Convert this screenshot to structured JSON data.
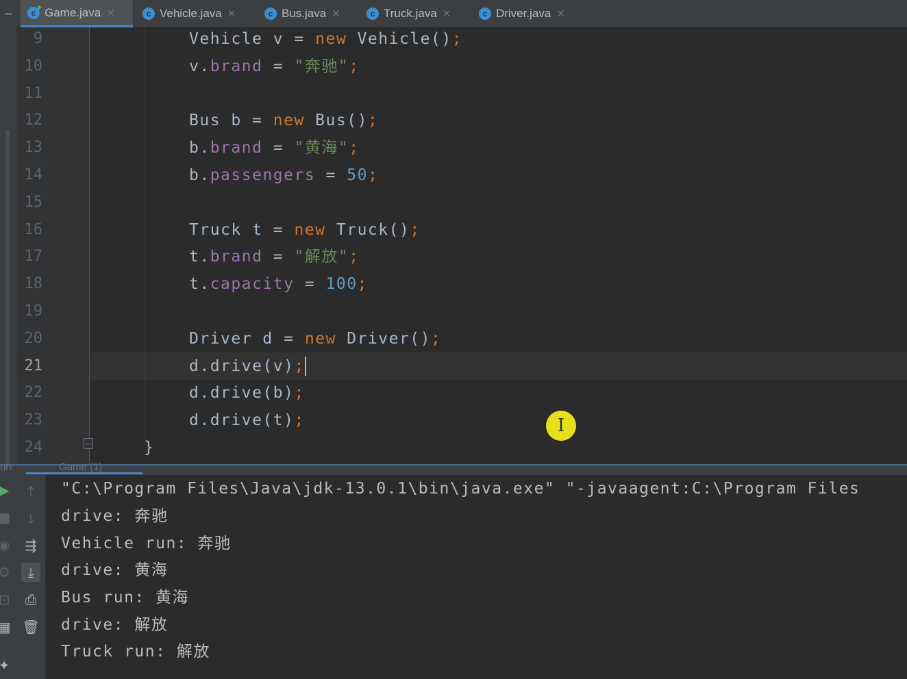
{
  "tabs": [
    {
      "label": "Game.java",
      "icon": "class-icon",
      "active": true
    },
    {
      "label": "Vehicle.java",
      "icon": "class-icon",
      "active": false
    },
    {
      "label": "Bus.java",
      "icon": "class-icon",
      "active": false
    },
    {
      "label": "Truck.java",
      "icon": "class-icon",
      "active": false
    },
    {
      "label": "Driver.java",
      "icon": "class-icon",
      "active": false
    }
  ],
  "editor": {
    "current_line": 21,
    "lines": [
      {
        "n": "9",
        "tokens": [
          [
            "p",
            "Vehicle v = "
          ],
          [
            "kw",
            "new"
          ],
          [
            "p",
            " Vehicle()"
          ],
          [
            "kw",
            ";"
          ]
        ]
      },
      {
        "n": "10",
        "tokens": [
          [
            "p",
            "v."
          ],
          [
            "fld",
            "brand"
          ],
          [
            "p",
            " = "
          ],
          [
            "str",
            "\"奔驰\""
          ],
          [
            "kw",
            ";"
          ]
        ]
      },
      {
        "n": "11",
        "tokens": []
      },
      {
        "n": "12",
        "tokens": [
          [
            "p",
            "Bus b = "
          ],
          [
            "kw",
            "new"
          ],
          [
            "p",
            " Bus()"
          ],
          [
            "kw",
            ";"
          ]
        ]
      },
      {
        "n": "13",
        "tokens": [
          [
            "p",
            "b."
          ],
          [
            "fld",
            "brand"
          ],
          [
            "p",
            " = "
          ],
          [
            "str",
            "\"黄海\""
          ],
          [
            "kw",
            ";"
          ]
        ]
      },
      {
        "n": "14",
        "tokens": [
          [
            "p",
            "b."
          ],
          [
            "fld",
            "passengers"
          ],
          [
            "p",
            " = "
          ],
          [
            "num",
            "50"
          ],
          [
            "kw",
            ";"
          ]
        ]
      },
      {
        "n": "15",
        "tokens": []
      },
      {
        "n": "16",
        "tokens": [
          [
            "p",
            "Truck t = "
          ],
          [
            "kw",
            "new"
          ],
          [
            "p",
            " Truck()"
          ],
          [
            "kw",
            ";"
          ]
        ]
      },
      {
        "n": "17",
        "tokens": [
          [
            "p",
            "t."
          ],
          [
            "fld",
            "brand"
          ],
          [
            "p",
            " = "
          ],
          [
            "str",
            "\"解放\""
          ],
          [
            "kw",
            ";"
          ]
        ]
      },
      {
        "n": "18",
        "tokens": [
          [
            "p",
            "t."
          ],
          [
            "fld",
            "capacity"
          ],
          [
            "p",
            " = "
          ],
          [
            "num",
            "100"
          ],
          [
            "kw",
            ";"
          ]
        ]
      },
      {
        "n": "19",
        "tokens": []
      },
      {
        "n": "20",
        "tokens": [
          [
            "p",
            "Driver d = "
          ],
          [
            "kw",
            "new"
          ],
          [
            "p",
            " Driver()"
          ],
          [
            "kw",
            ";"
          ]
        ]
      },
      {
        "n": "21",
        "tokens": [
          [
            "p",
            "d.drive(v)"
          ],
          [
            "kw",
            ";"
          ]
        ]
      },
      {
        "n": "22",
        "tokens": [
          [
            "p",
            "d.drive(b)"
          ],
          [
            "kw",
            ";"
          ]
        ]
      },
      {
        "n": "23",
        "tokens": [
          [
            "p",
            "d.drive(t)"
          ],
          [
            "kw",
            ";"
          ]
        ]
      },
      {
        "n": "24",
        "tokens": [
          [
            "p",
            "}"
          ]
        ],
        "brace": true
      }
    ]
  },
  "run_panel": {
    "tab_label": "Game (1)",
    "left_label": "un:",
    "console_lines": [
      "\"C:\\Program Files\\Java\\jdk-13.0.1\\bin\\java.exe\" \"-javaagent:C:\\Program Files",
      "drive: 奔驰",
      "Vehicle run: 奔驰",
      "drive: 黄海",
      "Bus run: 黄海",
      "drive: 解放",
      "Truck run: 解放"
    ],
    "toolbar_icons": [
      "up-arrow-icon",
      "down-arrow-icon",
      "soft-wrap-icon",
      "scroll-to-end-icon",
      "print-icon",
      "trash-icon"
    ]
  },
  "colors": {
    "keyword": "#cc7832",
    "field": "#9876aa",
    "string": "#6a8759",
    "number": "#6897bb",
    "plain": "#a9b7c6",
    "accent": "#4a88c7"
  }
}
